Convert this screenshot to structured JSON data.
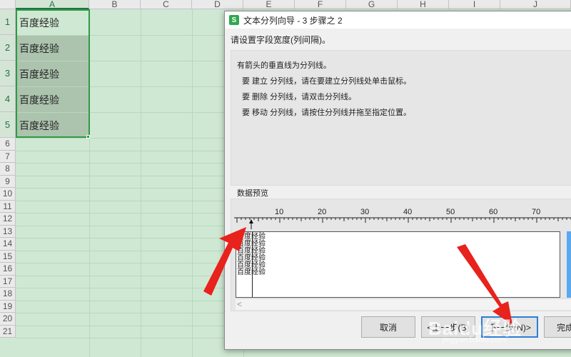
{
  "sheet": {
    "columns": [
      "A",
      "B",
      "C",
      "D",
      "E",
      "F",
      "G",
      "H",
      "I",
      "J"
    ],
    "rows": [
      "1",
      "2",
      "3",
      "4",
      "5",
      "6",
      "7",
      "8",
      "9",
      "10",
      "11",
      "12",
      "13",
      "14",
      "15",
      "16",
      "17",
      "18",
      "19",
      "20",
      "21"
    ],
    "cells": [
      "百度经验",
      "百度经验",
      "百度经验",
      "百度经验",
      "百度经验"
    ]
  },
  "dialog": {
    "title": "文本分列向导 - 3 步骤之 2",
    "app_icon_letter": "S",
    "prompt": "请设置字段宽度(列间隔)。",
    "instructions": {
      "heading": "有箭头的垂直线为分列线。",
      "create": "要 建立 分列线，请在要建立分列线处单击鼠标。",
      "delete": "要 删除 分列线，请双击分列线。",
      "move": "要 移动 分列线，请按住分列线并拖至指定位置。"
    },
    "preview_label": "数据预览",
    "ruler_labels": [
      "10",
      "20",
      "30",
      "40",
      "50",
      "60",
      "70"
    ],
    "preview_lines": [
      "百度经验",
      "百度经验",
      "百度经验",
      "百度经验",
      "百度经验",
      "百度经验"
    ],
    "buttons": {
      "cancel": "取消",
      "back": "<上一步(B)",
      "next": "下一步(N)>",
      "finish": "完成"
    }
  },
  "watermark": {
    "main": "Baidu经验",
    "sub": "jingyan.baidu.com"
  },
  "colors": {
    "arrow": "#e8221c",
    "sheet_bg": "#cfe8d3",
    "selection_border": "#2e9a45"
  }
}
